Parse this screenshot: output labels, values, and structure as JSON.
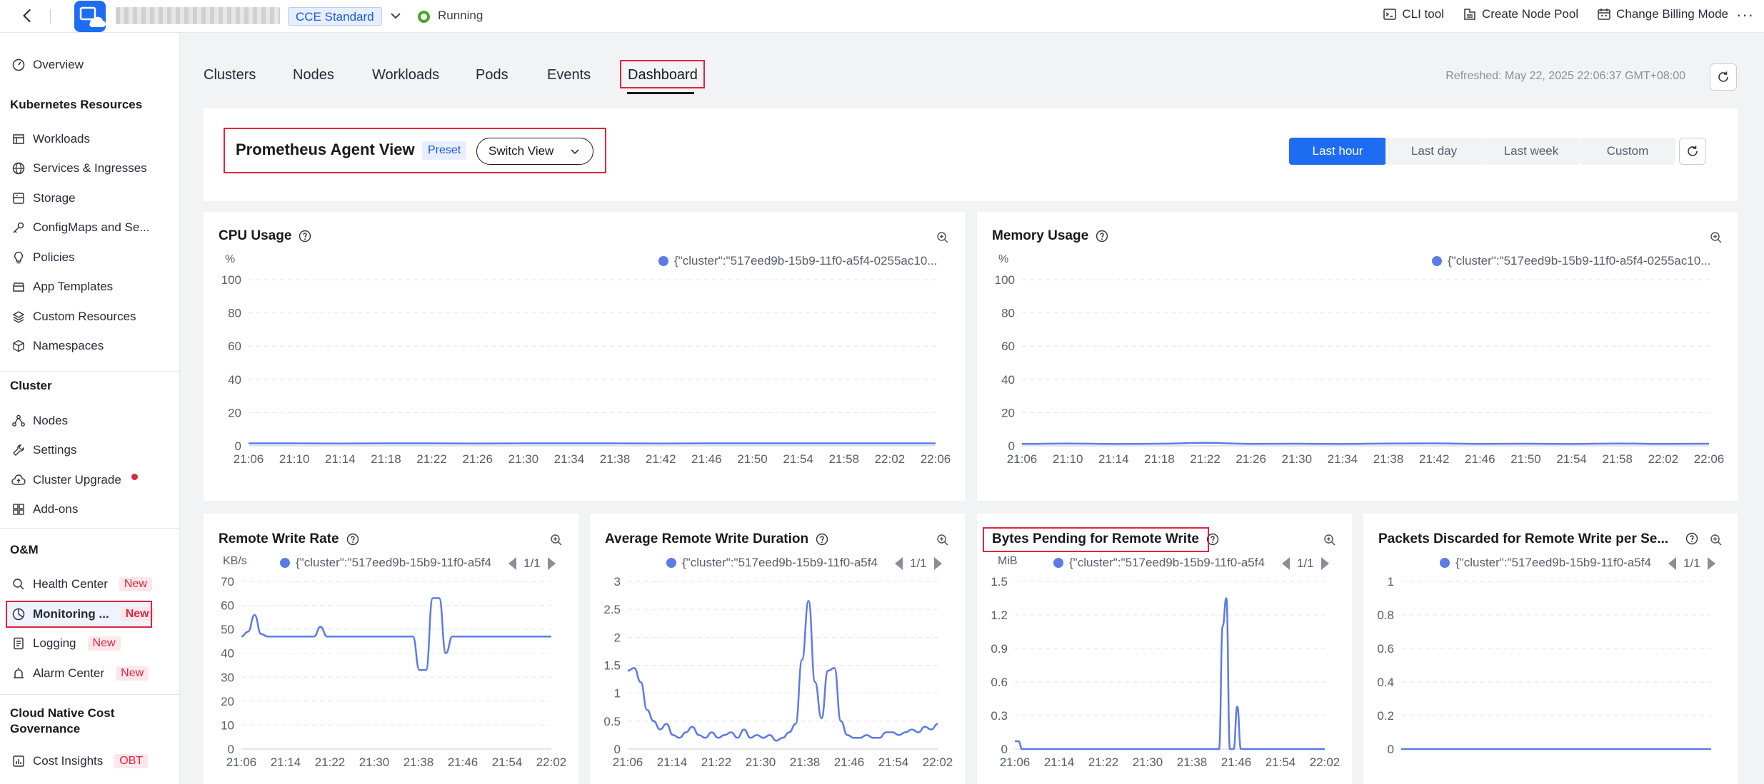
{
  "topbar": {
    "badge": "CCE Standard",
    "status": "Running",
    "actions": [
      {
        "label": "CLI tool",
        "icon": "terminal-icon"
      },
      {
        "label": "Create Node Pool",
        "icon": "node-pool-icon"
      },
      {
        "label": "Change Billing Mode",
        "icon": "billing-icon"
      }
    ],
    "more": "···"
  },
  "sidebar": {
    "overview": "Overview",
    "section_k8s": "Kubernetes Resources",
    "k8s_items": [
      "Workloads",
      "Services & Ingresses",
      "Storage",
      "ConfigMaps and Se...",
      "Policies",
      "App Templates",
      "Custom Resources",
      "Namespaces"
    ],
    "section_cluster": "Cluster",
    "cluster_items": [
      "Nodes",
      "Settings",
      "Cluster Upgrade",
      "Add-ons"
    ],
    "section_om": "O&M",
    "om_items": [
      {
        "label": "Health Center",
        "tag": "New"
      },
      {
        "label": "Monitoring ...",
        "tag": "New"
      },
      {
        "label": "Logging",
        "tag": "New"
      },
      {
        "label": "Alarm Center",
        "tag": "New"
      }
    ],
    "section_cost": "Cloud Native Cost Governance",
    "cost_items": [
      {
        "label": "Cost Insights",
        "tag": "OBT"
      }
    ]
  },
  "tabs": [
    "Clusters",
    "Nodes",
    "Workloads",
    "Pods",
    "Events",
    "Dashboard"
  ],
  "active_tab": "Dashboard",
  "refreshed": "Refreshed: May 22, 2025 22:06:37 GMT+08:00",
  "view": {
    "title": "Prometheus Agent View",
    "preset": "Preset",
    "switch_label": "Switch View",
    "ranges": [
      "Last hour",
      "Last day",
      "Last week",
      "Custom"
    ],
    "selected_range": "Last hour"
  },
  "colors": {
    "accent": "#1d6cf2",
    "series": "#5b7be6",
    "highlight": "#e0253f"
  },
  "chart_data": [
    {
      "type": "line",
      "title": "CPU Usage",
      "ylabel": "%",
      "legend": "{\"cluster\":\"517eed9b-15b9-11f0-a5f4-0255ac10...",
      "ylim": [
        0,
        100
      ],
      "yticks": [
        0,
        20,
        40,
        60,
        80,
        100
      ],
      "x": [
        "21:06",
        "21:10",
        "21:14",
        "21:18",
        "21:22",
        "21:26",
        "21:30",
        "21:34",
        "21:38",
        "21:42",
        "21:46",
        "21:50",
        "21:54",
        "21:58",
        "22:02",
        "22:06"
      ],
      "series": [
        {
          "values": [
            1.5,
            1.5,
            1.4,
            1.5,
            1.5,
            1.4,
            1.5,
            1.5,
            1.5,
            1.4,
            1.5,
            1.5,
            1.5,
            1.5,
            1.5,
            1.5
          ]
        }
      ]
    },
    {
      "type": "line",
      "title": "Memory Usage",
      "ylabel": "%",
      "legend": "{\"cluster\":\"517eed9b-15b9-11f0-a5f4-0255ac10...",
      "ylim": [
        0,
        100
      ],
      "yticks": [
        0,
        20,
        40,
        60,
        80,
        100
      ],
      "x": [
        "21:06",
        "21:10",
        "21:14",
        "21:18",
        "21:22",
        "21:26",
        "21:30",
        "21:34",
        "21:38",
        "21:42",
        "21:46",
        "21:50",
        "21:54",
        "21:58",
        "22:02",
        "22:06"
      ],
      "series": [
        {
          "values": [
            1.2,
            1.4,
            1.1,
            1.3,
            1.8,
            1.2,
            1.3,
            1.1,
            1.4,
            1.5,
            1.2,
            1.3,
            1.1,
            1.4,
            1.2,
            1.3
          ]
        }
      ]
    },
    {
      "type": "line",
      "title": "Remote Write Rate",
      "ylabel": "KB/s",
      "legend": "{\"cluster\":\"517eed9b-15b9-11f0-a5f4",
      "pager": "1/1",
      "ylim": [
        0,
        70
      ],
      "yticks": [
        0,
        10,
        20,
        30,
        40,
        50,
        60,
        70
      ],
      "x": [
        "21:06",
        "21:14",
        "21:22",
        "21:30",
        "21:38",
        "21:46",
        "21:54",
        "22:02"
      ],
      "series": [
        {
          "values": [
            47,
            49,
            56,
            48,
            47,
            47,
            47,
            47,
            47,
            47,
            47,
            47,
            51,
            47,
            47,
            47,
            47,
            47,
            47,
            47,
            47,
            47,
            47,
            47,
            47,
            47,
            47,
            33,
            33,
            63,
            63,
            40,
            47,
            47,
            47,
            47,
            47,
            47,
            47,
            47,
            47,
            47,
            47,
            47,
            47,
            47,
            47,
            47
          ]
        }
      ]
    },
    {
      "type": "line",
      "title": "Average Remote Write Duration",
      "ylabel": "",
      "legend": "{\"cluster\":\"517eed9b-15b9-11f0-a5f4",
      "pager": "1/1",
      "ylim": [
        0,
        3
      ],
      "yticks": [
        0,
        0.5,
        1,
        1.5,
        2,
        2.5,
        3
      ],
      "x": [
        "21:06",
        "21:14",
        "21:22",
        "21:30",
        "21:38",
        "21:46",
        "21:54",
        "22:02"
      ],
      "series": [
        {
          "values": [
            1.4,
            1.45,
            1.2,
            0.7,
            0.5,
            0.35,
            0.45,
            0.25,
            0.2,
            0.3,
            0.4,
            0.25,
            0.2,
            0.3,
            0.2,
            0.25,
            0.3,
            0.2,
            0.35,
            0.2,
            0.25,
            0.2,
            0.25,
            0.15,
            0.2,
            0.3,
            0.45,
            1.6,
            2.65,
            1.2,
            0.55,
            1.4,
            1.45,
            0.5,
            0.25,
            0.2,
            0.2,
            0.25,
            0.2,
            0.2,
            0.3,
            0.3,
            0.25,
            0.3,
            0.35,
            0.3,
            0.4,
            0.35,
            0.45
          ]
        }
      ]
    },
    {
      "type": "line",
      "title": "Bytes Pending for Remote Write",
      "ylabel": "MiB",
      "legend": "{\"cluster\":\"517eed9b-15b9-11f0-a5f4",
      "pager": "1/1",
      "ylim": [
        0,
        1.5
      ],
      "yticks": [
        0,
        0.3,
        0.6,
        0.9,
        1.2,
        1.5
      ],
      "x": [
        "21:06",
        "21:14",
        "21:22",
        "21:30",
        "21:38",
        "21:46",
        "21:54",
        "22:02"
      ],
      "series": [
        {
          "values": [
            0.07,
            0.07,
            0,
            0,
            0,
            0,
            0,
            0,
            0,
            0,
            0,
            0,
            0,
            0,
            0,
            0,
            0,
            0,
            0,
            0,
            0,
            0,
            0,
            0,
            0,
            0,
            0,
            0,
            0,
            0,
            0,
            0,
            0,
            0,
            0,
            0,
            0,
            0,
            0,
            0,
            0,
            0,
            0,
            0,
            0,
            0,
            0,
            0,
            0,
            0,
            0,
            0,
            0,
            0,
            0,
            0,
            0,
            1.1,
            1.35,
            0,
            0,
            0.38,
            0,
            0,
            0,
            0,
            0,
            0,
            0,
            0,
            0,
            0,
            0,
            0,
            0,
            0,
            0,
            0,
            0,
            0,
            0,
            0,
            0,
            0,
            0,
            0
          ]
        }
      ]
    },
    {
      "type": "line",
      "title": "Packets Discarded for Remote Write per Se...",
      "ylabel": "",
      "legend": "{\"cluster\":\"517eed9b-15b9-11f0-a5f4",
      "pager": "1/1",
      "ylim": [
        0,
        1
      ],
      "yticks": [
        0,
        0.2,
        0.4,
        0.6,
        0.8,
        1
      ],
      "x": [],
      "series": [
        {
          "values": [
            0,
            0
          ]
        }
      ]
    }
  ]
}
